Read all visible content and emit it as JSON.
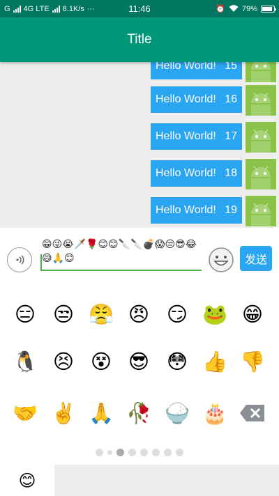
{
  "status_bar": {
    "carrier": "G",
    "network": "4G LTE",
    "speed": "8.1K/s",
    "more": "···",
    "time": "11:46",
    "battery": "79%",
    "icons": [
      "signal-icon",
      "alarm-icon",
      "wifi-icon",
      "battery-icon"
    ]
  },
  "app_bar": {
    "title": "Title"
  },
  "messages": [
    {
      "text": "Hello World!",
      "number": "15"
    },
    {
      "text": "Hello World!",
      "number": "16"
    },
    {
      "text": "Hello World!",
      "number": "17"
    },
    {
      "text": "Hello World!",
      "number": "18"
    },
    {
      "text": "Hello World!",
      "number": "19"
    }
  ],
  "input": {
    "value": "😁😜😭🗡️🌹😊😊🔪🔪💣😱😒😎😂😅🙏😊"
  },
  "send_label": "发送",
  "emoji_grid": [
    [
      "😑",
      "😒",
      "😤",
      "😠",
      "😏",
      "🐸",
      "😁"
    ],
    [
      "🐧",
      "😣",
      "😵",
      "😎",
      "😳",
      "👍",
      "👎"
    ],
    [
      "🤝",
      "✌️",
      "🙏",
      "🥀",
      "🍚",
      "🎂",
      "⌫"
    ]
  ],
  "pager": {
    "count": 8,
    "active_index": 2
  },
  "tab_emoji": "😊",
  "colors": {
    "status_bar": "#007560",
    "app_bar": "#009879",
    "bubble": "#2aa5f2",
    "send": "#2aa5f2",
    "input_underline": "#4caf50",
    "avatar": "#8bc34a"
  }
}
